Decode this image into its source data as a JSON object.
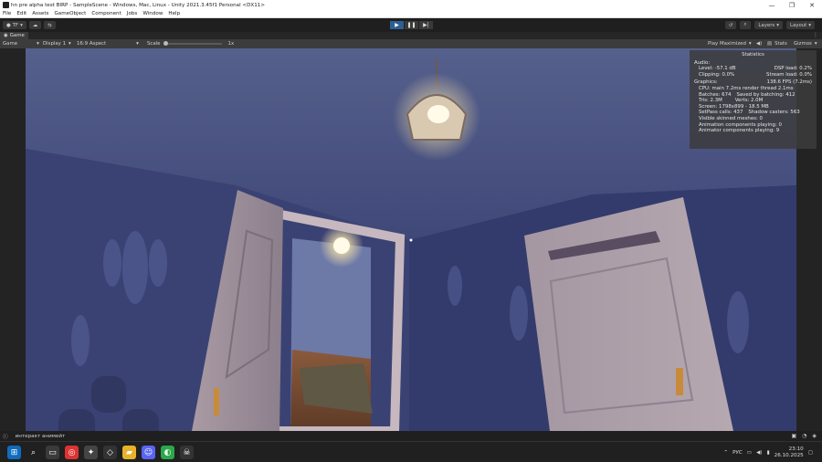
{
  "window": {
    "title": "hn pre alpha test BIRP - SampleScene - Windows, Mac, Linux - Unity 2021.3.45f1 Personal <DX11>",
    "minimize": "—",
    "maximize": "❐",
    "close": "✕"
  },
  "menu": [
    "File",
    "Edit",
    "Assets",
    "GameObject",
    "Component",
    "Jobs",
    "Window",
    "Help"
  ],
  "toolbar": {
    "account_label": "TF",
    "layers_label": "Layers",
    "layout_label": "Layout"
  },
  "game_tab": {
    "label": "Game"
  },
  "game_controls": {
    "mode": "Game",
    "display": "Display 1",
    "aspect": "16:9 Aspect",
    "scale_label": "Scale",
    "scale_value": "1x",
    "play_mode": "Play Maximized",
    "stats_label": "Stats",
    "gizmos_label": "Gizmos"
  },
  "stats": {
    "title": "Statistics",
    "audio_heading": "Audio:",
    "level": "Level: -57.1 dB",
    "clipping": "Clipping: 0.0%",
    "dsp_load": "DSP load: 0.2%",
    "stream_load": "Stream load: 0.0%",
    "graphics_heading": "Graphics:",
    "fps": "138.6 FPS (7.2ms)",
    "cpu": "CPU: main 7.2ms  render thread 2.1ms",
    "batches": "Batches: 674",
    "saved_batching": "Saved by batching: 412",
    "tris": "Tris: 2.3M",
    "verts": "Verts: 2.0M",
    "screen": "Screen: 1798x899 - 18.5 MB",
    "setpass": "SetPass calls: 437",
    "shadow_casters": "Shadow casters: 563",
    "skinned": "Visible skinned meshes: 0",
    "anim_components": "Animation components playing: 0",
    "animator_components": "Animator components playing: 9"
  },
  "status_bar": {
    "message": "интеракт анимейт"
  },
  "taskbar": {
    "language": "РУС",
    "time": "23:10",
    "date": "26.10.2025"
  }
}
